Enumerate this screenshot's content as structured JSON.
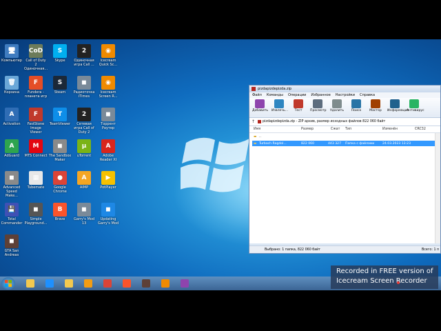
{
  "desktop_icons": [
    {
      "label": "Компьютер",
      "color": "#3f7cc0",
      "glyph": "🖥"
    },
    {
      "label": "Call of Duty 2 Одиночная...",
      "color": "#6c7b5a",
      "glyph": "CoD"
    },
    {
      "label": "Skype",
      "color": "#00aff0",
      "glyph": "S"
    },
    {
      "label": "Одиночная игра Call ...",
      "color": "#222",
      "glyph": "2"
    },
    {
      "label": "Icecream Quick Sc...",
      "color": "#f08a00",
      "glyph": "◉"
    },
    {
      "label": "Корзина",
      "color": "#6aa7d8",
      "glyph": "🗑"
    },
    {
      "label": "Fundera - планета игр",
      "color": "#e44d26",
      "glyph": "F"
    },
    {
      "label": "Steam",
      "color": "#1b2838",
      "glyph": "S"
    },
    {
      "label": "Радиоточка iTimes",
      "color": "#7a8a99",
      "glyph": "◼"
    },
    {
      "label": "Icecream Screen R...",
      "color": "#f08a00",
      "glyph": "◉"
    },
    {
      "label": "Activation",
      "color": "#2f6db5",
      "glyph": "A"
    },
    {
      "label": "FastStone Image Viewer",
      "color": "#c0392b",
      "glyph": "F"
    },
    {
      "label": "TeamViewer",
      "color": "#0e8ee9",
      "glyph": "T"
    },
    {
      "label": "Сетевая игра Call of Duty 2",
      "color": "#222",
      "glyph": "2"
    },
    {
      "label": "Торрент Раутер",
      "color": "#7a8a99",
      "glyph": "◼"
    },
    {
      "label": "AdGuard",
      "color": "#2ea44f",
      "glyph": "A"
    },
    {
      "label": "MTS Connect",
      "color": "#e30611",
      "glyph": "M"
    },
    {
      "label": "The Sandbox Maker",
      "color": "#8a8a8a",
      "glyph": "◼"
    },
    {
      "label": "uTorrent",
      "color": "#7ab317",
      "glyph": "µ"
    },
    {
      "label": "Adobe Reader XI",
      "color": "#d9261c",
      "glyph": "A"
    },
    {
      "label": "Advanced Speed Make...",
      "color": "#8a8a8a",
      "glyph": "◼"
    },
    {
      "label": "Tubemate",
      "color": "#e8e8e8",
      "glyph": "▦"
    },
    {
      "label": "Google Chrome",
      "color": "#db4437",
      "glyph": "●"
    },
    {
      "label": "AIMP",
      "color": "#f5a623",
      "glyph": "A"
    },
    {
      "label": "PotPlayer",
      "color": "#f6c100",
      "glyph": "▶"
    },
    {
      "label": "Total Commander",
      "color": "#3f51b5",
      "glyph": "💾"
    },
    {
      "label": "Simple Playground...",
      "color": "#555",
      "glyph": "◼"
    },
    {
      "label": "Brave",
      "color": "#fb542b",
      "glyph": "B"
    },
    {
      "label": "Garry's Mod 13",
      "color": "#7a8a99",
      "glyph": "◼"
    },
    {
      "label": "Updating Garry's Mod",
      "color": "#1e88e5",
      "glyph": "◼"
    },
    {
      "label": "GTA San Andreas",
      "color": "#5d4037",
      "glyph": "◼"
    }
  ],
  "window": {
    "title": "pizdapizdepizda.zip",
    "menu": [
      "Файл",
      "Команды",
      "Операции",
      "Избранное",
      "Настройки",
      "Справка"
    ],
    "toolbar": [
      {
        "label": "Добавить",
        "color": "#8e44ad"
      },
      {
        "label": "Извлечь...",
        "color": "#2e86c1"
      },
      {
        "label": "Тест",
        "color": "#c0392b"
      },
      {
        "label": "Просмотр",
        "color": "#5d6d7e"
      },
      {
        "label": "Удалить",
        "color": "#7f8c8d"
      },
      {
        "label": "Поиск",
        "color": "#2874a6"
      },
      {
        "label": "Мастер",
        "color": "#a04000"
      },
      {
        "label": "Информация",
        "color": "#1f618d"
      },
      {
        "label": "Антивирус",
        "color": "#28b463"
      }
    ],
    "address": "pizdapizdepizda.zip - ZIP архив, размер исходных файлов 822 060 байт",
    "columns": [
      "Имя",
      "Размер",
      "Сжат",
      "Тип",
      "Изменён",
      "CRC32"
    ],
    "rows": [
      {
        "name": "..",
        "size": "",
        "packed": "",
        "type": "Папка с файлами",
        "modified": "",
        "selected": false
      },
      {
        "name": "Turbach Ragdol...",
        "size": "822 060",
        "packed": "443 327",
        "type": "Папка с файлами",
        "modified": "24.03.2023 13:23",
        "selected": true
      }
    ],
    "status_left": "Выбрано: 1 папка, 822 060 байт",
    "status_right": "Всего: 1 п"
  },
  "taskbar": [
    {
      "name": "explorer",
      "color": "#f3c94f"
    },
    {
      "name": "ie",
      "color": "#1e90ff"
    },
    {
      "name": "folder",
      "color": "#f3c94f"
    },
    {
      "name": "media",
      "color": "#f39c12"
    },
    {
      "name": "chrome",
      "color": "#db4437"
    },
    {
      "name": "brave",
      "color": "#fb542b"
    },
    {
      "name": "game",
      "color": "#5d4037"
    },
    {
      "name": "icecream",
      "color": "#f08a00"
    },
    {
      "name": "winrar",
      "color": "#8e44ad"
    }
  ],
  "watermark": {
    "line1": "Recorded in FREE version of",
    "line2": "Icecream   Screen   Recorder"
  }
}
